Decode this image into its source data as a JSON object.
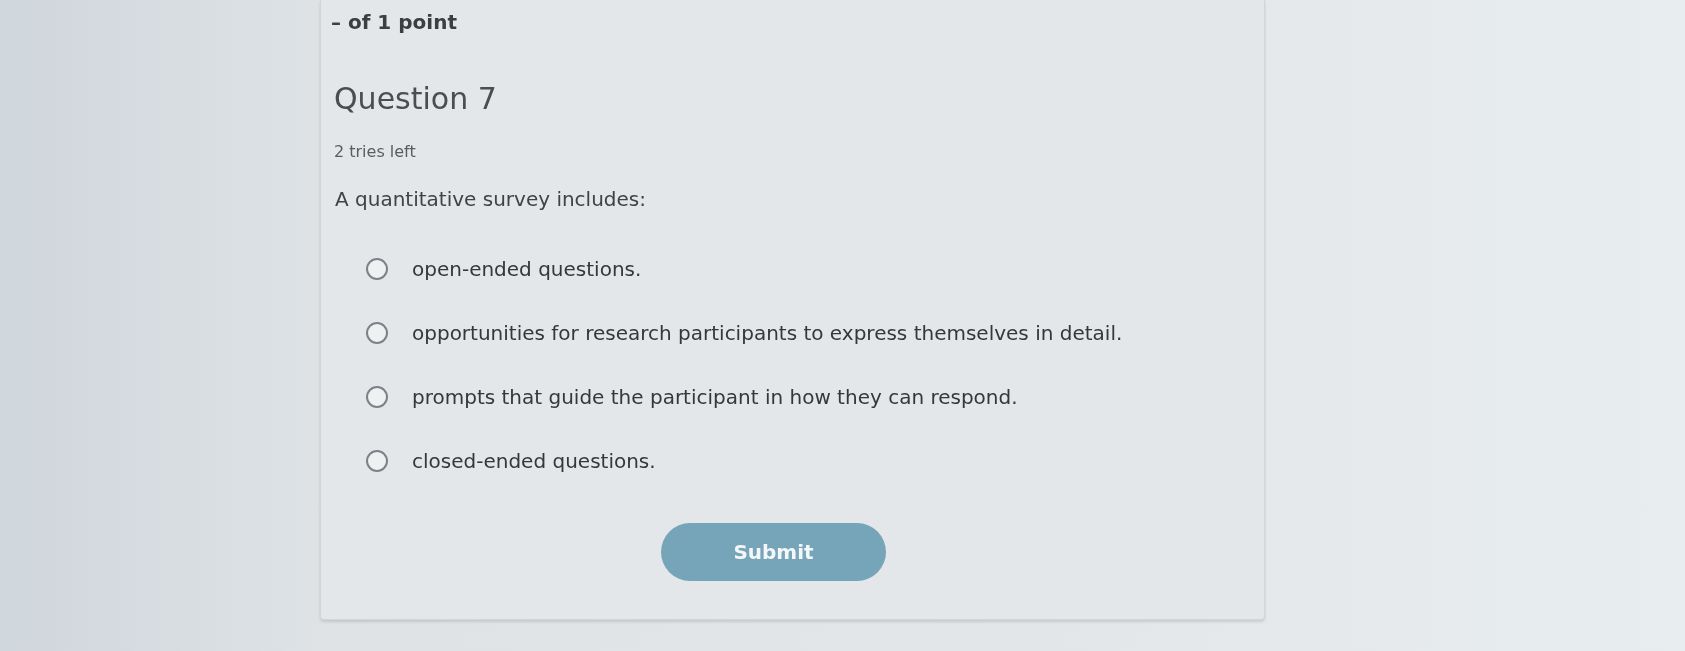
{
  "score": "– of 1 point",
  "question": {
    "title": "Question 7",
    "tries": "2 tries left",
    "prompt": "A quantitative survey includes:"
  },
  "options": [
    {
      "label": "open-ended questions.",
      "selected": false
    },
    {
      "label": "opportunities for research participants to express themselves in detail.",
      "selected": false
    },
    {
      "label": "prompts that guide the participant in how they can respond.",
      "selected": false
    },
    {
      "label": "closed-ended questions.",
      "selected": false
    }
  ],
  "submit": {
    "label": "Submit"
  }
}
